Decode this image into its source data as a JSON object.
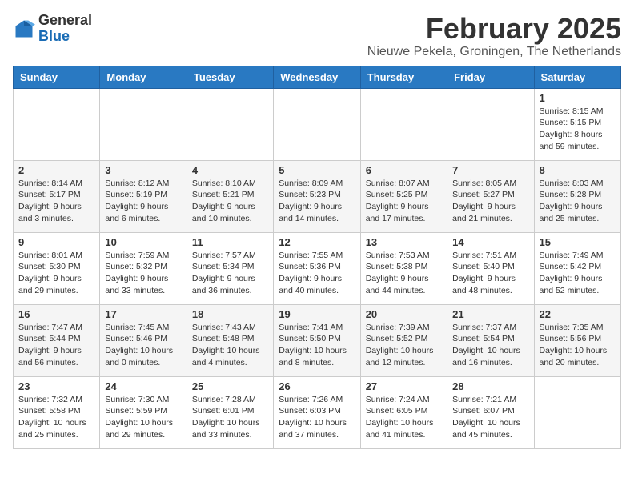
{
  "logo": {
    "general": "General",
    "blue": "Blue"
  },
  "header": {
    "month_year": "February 2025",
    "location": "Nieuwe Pekela, Groningen, The Netherlands"
  },
  "weekdays": [
    "Sunday",
    "Monday",
    "Tuesday",
    "Wednesday",
    "Thursday",
    "Friday",
    "Saturday"
  ],
  "weeks": [
    [
      {
        "day": "",
        "info": ""
      },
      {
        "day": "",
        "info": ""
      },
      {
        "day": "",
        "info": ""
      },
      {
        "day": "",
        "info": ""
      },
      {
        "day": "",
        "info": ""
      },
      {
        "day": "",
        "info": ""
      },
      {
        "day": "1",
        "info": "Sunrise: 8:15 AM\nSunset: 5:15 PM\nDaylight: 8 hours and 59 minutes."
      }
    ],
    [
      {
        "day": "2",
        "info": "Sunrise: 8:14 AM\nSunset: 5:17 PM\nDaylight: 9 hours and 3 minutes."
      },
      {
        "day": "3",
        "info": "Sunrise: 8:12 AM\nSunset: 5:19 PM\nDaylight: 9 hours and 6 minutes."
      },
      {
        "day": "4",
        "info": "Sunrise: 8:10 AM\nSunset: 5:21 PM\nDaylight: 9 hours and 10 minutes."
      },
      {
        "day": "5",
        "info": "Sunrise: 8:09 AM\nSunset: 5:23 PM\nDaylight: 9 hours and 14 minutes."
      },
      {
        "day": "6",
        "info": "Sunrise: 8:07 AM\nSunset: 5:25 PM\nDaylight: 9 hours and 17 minutes."
      },
      {
        "day": "7",
        "info": "Sunrise: 8:05 AM\nSunset: 5:27 PM\nDaylight: 9 hours and 21 minutes."
      },
      {
        "day": "8",
        "info": "Sunrise: 8:03 AM\nSunset: 5:28 PM\nDaylight: 9 hours and 25 minutes."
      }
    ],
    [
      {
        "day": "9",
        "info": "Sunrise: 8:01 AM\nSunset: 5:30 PM\nDaylight: 9 hours and 29 minutes."
      },
      {
        "day": "10",
        "info": "Sunrise: 7:59 AM\nSunset: 5:32 PM\nDaylight: 9 hours and 33 minutes."
      },
      {
        "day": "11",
        "info": "Sunrise: 7:57 AM\nSunset: 5:34 PM\nDaylight: 9 hours and 36 minutes."
      },
      {
        "day": "12",
        "info": "Sunrise: 7:55 AM\nSunset: 5:36 PM\nDaylight: 9 hours and 40 minutes."
      },
      {
        "day": "13",
        "info": "Sunrise: 7:53 AM\nSunset: 5:38 PM\nDaylight: 9 hours and 44 minutes."
      },
      {
        "day": "14",
        "info": "Sunrise: 7:51 AM\nSunset: 5:40 PM\nDaylight: 9 hours and 48 minutes."
      },
      {
        "day": "15",
        "info": "Sunrise: 7:49 AM\nSunset: 5:42 PM\nDaylight: 9 hours and 52 minutes."
      }
    ],
    [
      {
        "day": "16",
        "info": "Sunrise: 7:47 AM\nSunset: 5:44 PM\nDaylight: 9 hours and 56 minutes."
      },
      {
        "day": "17",
        "info": "Sunrise: 7:45 AM\nSunset: 5:46 PM\nDaylight: 10 hours and 0 minutes."
      },
      {
        "day": "18",
        "info": "Sunrise: 7:43 AM\nSunset: 5:48 PM\nDaylight: 10 hours and 4 minutes."
      },
      {
        "day": "19",
        "info": "Sunrise: 7:41 AM\nSunset: 5:50 PM\nDaylight: 10 hours and 8 minutes."
      },
      {
        "day": "20",
        "info": "Sunrise: 7:39 AM\nSunset: 5:52 PM\nDaylight: 10 hours and 12 minutes."
      },
      {
        "day": "21",
        "info": "Sunrise: 7:37 AM\nSunset: 5:54 PM\nDaylight: 10 hours and 16 minutes."
      },
      {
        "day": "22",
        "info": "Sunrise: 7:35 AM\nSunset: 5:56 PM\nDaylight: 10 hours and 20 minutes."
      }
    ],
    [
      {
        "day": "23",
        "info": "Sunrise: 7:32 AM\nSunset: 5:58 PM\nDaylight: 10 hours and 25 minutes."
      },
      {
        "day": "24",
        "info": "Sunrise: 7:30 AM\nSunset: 5:59 PM\nDaylight: 10 hours and 29 minutes."
      },
      {
        "day": "25",
        "info": "Sunrise: 7:28 AM\nSunset: 6:01 PM\nDaylight: 10 hours and 33 minutes."
      },
      {
        "day": "26",
        "info": "Sunrise: 7:26 AM\nSunset: 6:03 PM\nDaylight: 10 hours and 37 minutes."
      },
      {
        "day": "27",
        "info": "Sunrise: 7:24 AM\nSunset: 6:05 PM\nDaylight: 10 hours and 41 minutes."
      },
      {
        "day": "28",
        "info": "Sunrise: 7:21 AM\nSunset: 6:07 PM\nDaylight: 10 hours and 45 minutes."
      },
      {
        "day": "",
        "info": ""
      }
    ]
  ]
}
